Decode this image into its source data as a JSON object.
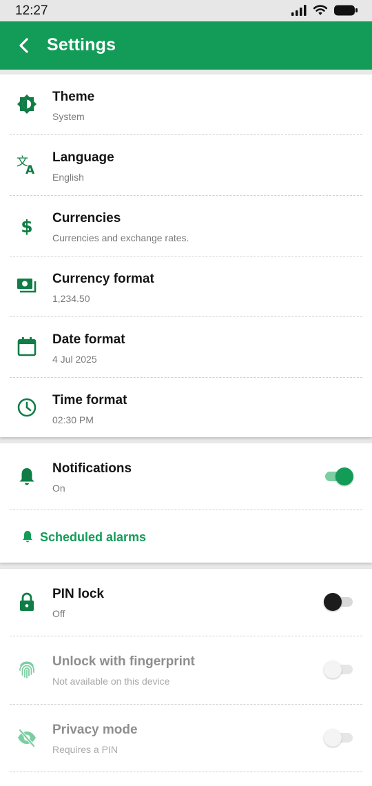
{
  "status_bar": {
    "time": "12:27"
  },
  "app_bar": {
    "title": "Settings"
  },
  "colors": {
    "accent": "#129c58",
    "app_bar": "#129c58"
  },
  "general": [
    {
      "title": "Theme",
      "subtitle": "System",
      "icon": "theme-icon"
    },
    {
      "title": "Language",
      "subtitle": "English",
      "icon": "translate-icon"
    },
    {
      "title": "Currencies",
      "subtitle": "Currencies and exchange rates.",
      "icon": "dollar-icon"
    },
    {
      "title": "Currency format",
      "subtitle": "1,234.50",
      "icon": "cash-icon"
    },
    {
      "title": "Date format",
      "subtitle": "4 Jul 2025",
      "icon": "calendar-icon"
    },
    {
      "title": "Time format",
      "subtitle": "02:30 PM",
      "icon": "clock-icon"
    }
  ],
  "notifications": {
    "title": "Notifications",
    "subtitle": "On",
    "enabled": true,
    "link_label": "Scheduled alarms"
  },
  "security": [
    {
      "title": "PIN lock",
      "subtitle": "Off",
      "enabled": false,
      "available": true,
      "icon": "lock-icon"
    },
    {
      "title": "Unlock with fingerprint",
      "subtitle": "Not available on this device",
      "enabled": false,
      "available": false,
      "icon": "fingerprint-icon"
    },
    {
      "title": "Privacy mode",
      "subtitle": "Requires a PIN",
      "enabled": false,
      "available": false,
      "icon": "eye-off-icon"
    }
  ]
}
